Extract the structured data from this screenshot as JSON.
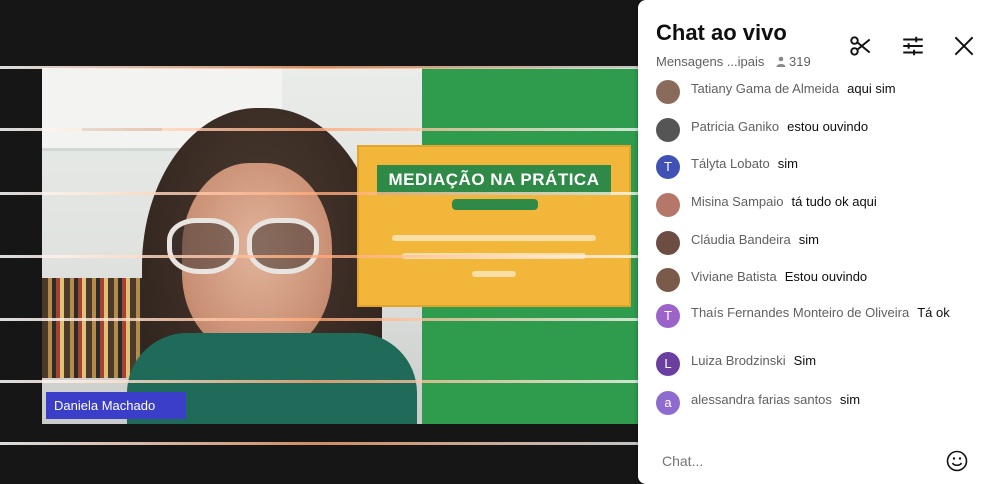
{
  "video": {
    "slide_title": "MEDIAÇÃO NA PRÁTICA",
    "presenter_name": "Daniela Machado"
  },
  "chat": {
    "title": "Chat ao vivo",
    "mode_label": "Mensagens ...ipais",
    "viewer_count": "319",
    "input_placeholder": "Chat...",
    "icons": {
      "clip": "scissors-icon",
      "settings": "sliders-icon",
      "close": "close-icon",
      "emoji": "emoji-icon"
    },
    "messages": [
      {
        "author": "Tatiany Gama de Almeida",
        "text": "aqui sim",
        "avatar": "photo",
        "avatar_color": "#8a6a5a"
      },
      {
        "author": "Patricia Ganiko",
        "text": "estou ouvindo",
        "avatar": "photo",
        "avatar_color": "#555555"
      },
      {
        "author": "Tályta Lobato",
        "text": "sim",
        "avatar": "T",
        "avatar_color": "#3f51b5"
      },
      {
        "author": "Misina Sampaio",
        "text": "tá tudo ok aqui",
        "avatar": "photo",
        "avatar_color": "#b4776a"
      },
      {
        "author": "Cláudia Bandeira",
        "text": "sim",
        "avatar": "photo",
        "avatar_color": "#6d4c41"
      },
      {
        "author": "Viviane Batista",
        "text": "Estou ouvindo",
        "avatar": "photo",
        "avatar_color": "#7a5a48"
      },
      {
        "author": "Thaís Fernandes Monteiro de Oliveira",
        "text": "Tá ok",
        "avatar": "T",
        "avatar_color": "#9c64c9"
      },
      {
        "author": "Luiza Brodzinski",
        "text": "Sim",
        "avatar": "L",
        "avatar_color": "#6a3fa0"
      },
      {
        "author": "alessandra farias santos",
        "text": "sim",
        "avatar": "a",
        "avatar_color": "#8e6ccf"
      }
    ]
  }
}
